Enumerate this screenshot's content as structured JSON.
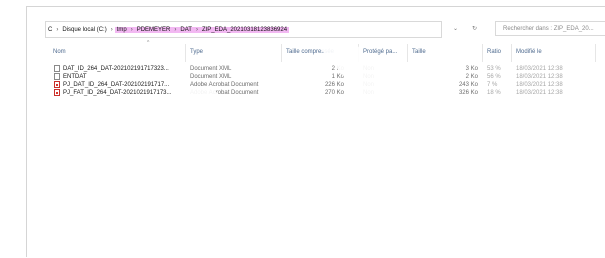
{
  "address": {
    "crumbs": [
      "C",
      "Disque local (C:)",
      "tmp",
      "PDEMEYER",
      "DAT",
      "ZIP_EDA_20210318123836924"
    ],
    "separator": "›"
  },
  "address_controls": {
    "dropdown": "⌄",
    "refresh": "↻"
  },
  "search": {
    "placeholder": "Rechercher dans : ZIP_EDA_20..."
  },
  "columns": {
    "name": "Nom",
    "type": "Type",
    "compressed": "Taille compressée",
    "protected": "Protégé pa...",
    "size": "Taille",
    "ratio": "Ratio",
    "modified": "Modifié le"
  },
  "files": [
    {
      "name": "DAT_ID_264_DAT-202102191717323...",
      "type": "Document XML",
      "compressed": "2 Ko",
      "protected": "Non",
      "size": "3 Ko",
      "ratio": "53 %",
      "modified": "18/03/2021 12:38",
      "icon": "xml-file-icon"
    },
    {
      "name": "ENTDAT",
      "type": "Document XML",
      "compressed": "1 Ko",
      "protected": "Non",
      "size": "2 Ko",
      "ratio": "56 %",
      "modified": "18/03/2021 12:38",
      "icon": "xml-file-icon"
    },
    {
      "name": "PJ_DAT_ID_264_DAT-202102191717...",
      "type": "Adobe Acrobat Document",
      "compressed": "226 Ko",
      "protected": "Non",
      "size": "243 Ko",
      "ratio": "7 %",
      "modified": "18/03/2021 12:38",
      "icon": "pdf-file-icon"
    },
    {
      "name": "PJ_FAT_ID_264_DAT-2021021917173...",
      "type": "Adobe Acrobat Document",
      "compressed": "270 Ko",
      "protected": "Non",
      "size": "326 Ko",
      "ratio": "18 %",
      "modified": "18/03/2021 12:38",
      "icon": "pdf-file-icon"
    }
  ]
}
